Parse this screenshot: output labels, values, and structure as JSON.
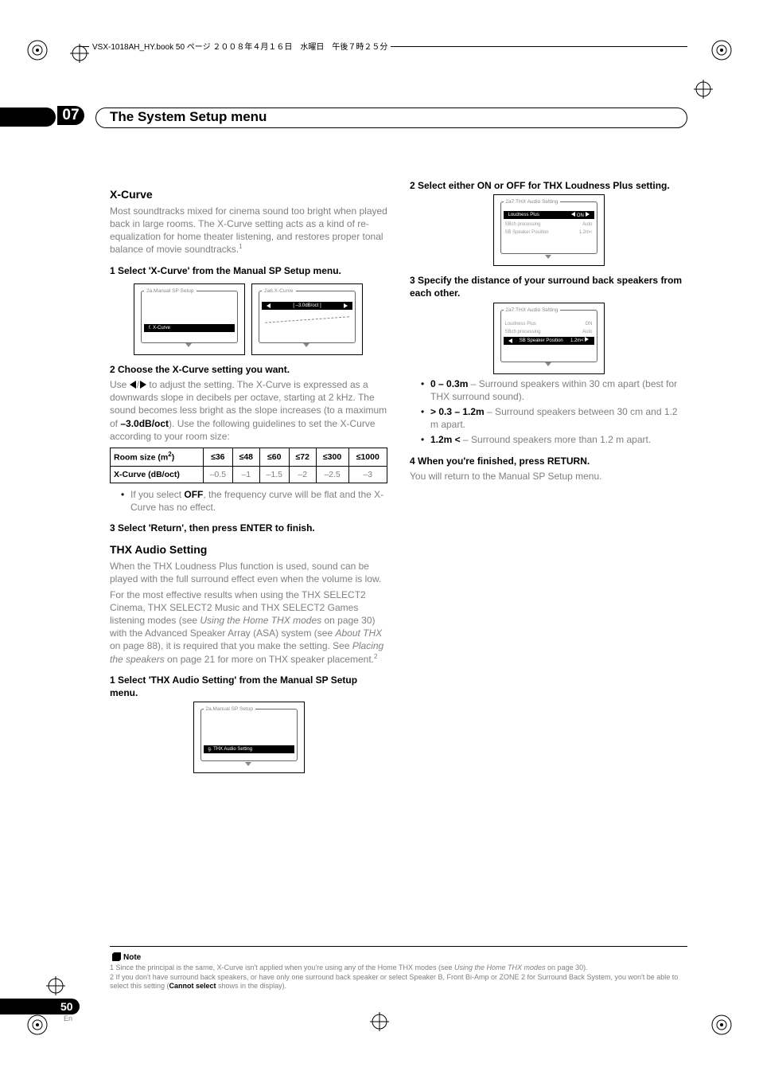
{
  "header": {
    "bookline": "VSX-1018AH_HY.book  50 ページ  ２００８年４月１６日　水曜日　午後７時２５分"
  },
  "chapter": {
    "num": "07",
    "title": "The System Setup menu"
  },
  "left": {
    "sec1_title": "X-Curve",
    "sec1_para": "Most soundtracks mixed for cinema sound too bright when played back in large rooms. The X-Curve setting acts as a kind of re-equalization for home theater listening, and restores proper tonal balance of movie soundtracks.",
    "sec1_sup": "1",
    "step1": "1    Select 'X-Curve' from the Manual SP Setup menu.",
    "osd1a_title": "2a.Manual SP Setup",
    "osd1a_sel_l": "f. X-Curve",
    "osd1b_title": "2a6.X-Curve",
    "osd1b_sel_c": "[ –3.0dB/oct ]",
    "step2": "2    Choose the X-Curve setting you want.",
    "step2_para_a": "Use ",
    "step2_para_b": " to adjust the setting. The X-Curve is expressed as a downwards slope in decibels per octave, starting at 2 kHz. The sound becomes less bright as the slope increases (to a maximum of ",
    "step2_bold": "–3.0dB/oct",
    "step2_para_c": "). Use the following guidelines to set the X-Curve according to your room size:",
    "table": {
      "h0": "Room size (m",
      "h0sup": "2",
      "h0end": ")",
      "cols": [
        "≤36",
        "≤48",
        "≤60",
        "≤72",
        "≤300",
        "≤1000"
      ],
      "row_label": "X-Curve (dB/oct)",
      "row": [
        "–0.5",
        "–1",
        "–1.5",
        "–2",
        "–2.5",
        "–3"
      ]
    },
    "bullet_off_a": "If you select ",
    "bullet_off_b": "OFF",
    "bullet_off_c": ", the frequency curve will be flat and the X-Curve has no effect.",
    "step3": "3    Select 'Return', then press ENTER to finish.",
    "sec2_title": "THX Audio Setting",
    "sec2_para1": "When the THX Loudness Plus function is used, sound can be played with the full surround effect even when the volume is low.",
    "sec2_para2a": "For the most effective results when using the THX SELECT2 Cinema, THX SELECT2 Music and THX SELECT2 Games listening modes (see ",
    "sec2_para2_i1": "Using the Home THX modes",
    "sec2_para2b": " on page 30) with the Advanced Speaker Array (ASA) system (see ",
    "sec2_para2_i2": "About THX",
    "sec2_para2c": " on page 88), it is required that you make the setting. See ",
    "sec2_para2_i3": "Placing the speakers",
    "sec2_para2d": " on page 21 for more on THX speaker placement.",
    "sec2_sup": "2",
    "step_thx1": "1    Select 'THX Audio Setting' from the Manual SP Setup menu.",
    "osd_thx1_title": "2a.Manual SP Setup",
    "osd_thx1_sel": "g. THX Audio Setting"
  },
  "right": {
    "step2": "2    Select either ON or OFF for THX Loudness Plus setting.",
    "osd2_title": "2a7.THX Audio Setting",
    "osd2_line1_l": "Loudness Plus",
    "osd2_sel_c": "ON",
    "osd2_line2_l": "SBch processing",
    "osd2_line2_r": "Auto",
    "osd2_line3_l": "SB Speaker Position",
    "osd2_line3_r": "1.2m<",
    "step3": "3    Specify the distance of your surround back speakers from each other.",
    "osd3_title": "2a7.THX Audio Setting",
    "osd3_line1_l": "Loudness Plus",
    "osd3_line1_r": "ON",
    "osd3_line2_l": "SBch processing",
    "osd3_line2_r": "Auto",
    "osd3_sel_l": "SB Speaker Position",
    "osd3_sel_r": "1.2m<",
    "bullets": [
      {
        "b": "0 – 0.3m",
        "t": " – Surround speakers within 30 cm apart (best for THX surround sound)."
      },
      {
        "b": "> 0.3 – 1.2m",
        "t": " – Surround speakers between 30 cm and 1.2 m apart."
      },
      {
        "b": "1.2m <",
        "t": " – Surround speakers more than 1.2 m apart."
      }
    ],
    "step4": "4    When you're finished, press RETURN.",
    "step4_para": "You will return to the Manual SP Setup menu."
  },
  "notes": {
    "label": "Note",
    "n1a": "1 Since the principal is the same, X-Curve isn't applied when you're using any of the Home THX modes (see ",
    "n1i": "Using the Home THX modes",
    "n1b": " on page 30).",
    "n2a": "2 If you don't have surround back speakers, or have only one surround back speaker or select Speaker B, Front Bi-Amp or ZONE 2 for Surround Back System, you won't be able to select this setting (",
    "n2bold": "Cannot select",
    "n2b": " shows in the display)."
  },
  "page": {
    "num": "50",
    "lang": "En"
  },
  "chart_data": {
    "type": "table",
    "title": "X-Curve vs Room size",
    "columns": [
      "Room size (m²)",
      "≤36",
      "≤48",
      "≤60",
      "≤72",
      "≤300",
      "≤1000"
    ],
    "rows": [
      [
        "X-Curve (dB/oct)",
        -0.5,
        -1,
        -1.5,
        -2,
        -2.5,
        -3
      ]
    ]
  }
}
